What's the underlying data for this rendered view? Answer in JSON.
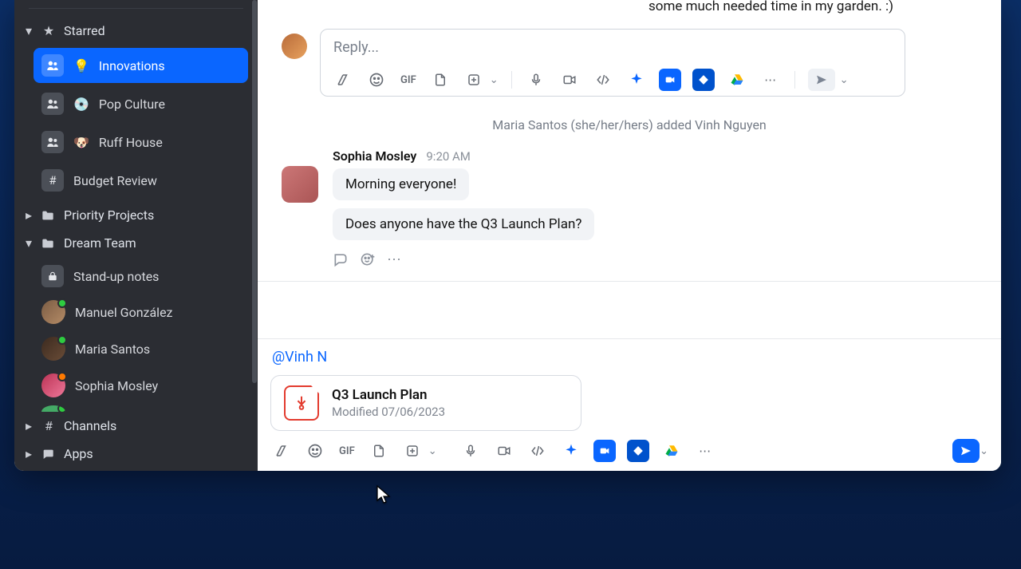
{
  "sidebar": {
    "sections": {
      "starred": {
        "label": "Starred"
      },
      "priority": {
        "label": "Priority Projects"
      },
      "dream": {
        "label": "Dream Team"
      },
      "channels": {
        "label": "Channels"
      },
      "apps": {
        "label": "Apps"
      }
    },
    "starred_channels": [
      {
        "label": "Innovations",
        "emoji": "💡",
        "active": true
      },
      {
        "label": "Pop Culture",
        "emoji": "💿",
        "active": false
      },
      {
        "label": "Ruff House",
        "emoji": "🐶",
        "active": false
      },
      {
        "label": "Budget Review",
        "emoji": "#",
        "active": false
      }
    ],
    "dream_items": [
      {
        "type": "channel",
        "label": "Stand-up notes",
        "icon": "lock"
      },
      {
        "type": "dm",
        "label": "Manuel González",
        "presence": "green"
      },
      {
        "type": "dm",
        "label": "Maria Santos",
        "presence": "green"
      },
      {
        "type": "dm",
        "label": "Sophia Mosley",
        "presence": "orange"
      }
    ]
  },
  "chat": {
    "partial_message": "some much needed time in my garden. :)",
    "reply_placeholder": "Reply...",
    "system_event": "Maria Santos (she/her/hers) added Vinh Nguyen",
    "message": {
      "author": "Sophia Mosley",
      "time": "9:20 AM",
      "body1": "Morning everyone!",
      "body2": "Does anyone have the Q3 Launch Plan?"
    },
    "composer_text_mention": "@Vinh N",
    "attachment": {
      "title": "Q3 Launch Plan",
      "subtitle": "Modified 07/06/2023"
    },
    "gif_label": "GIF"
  },
  "colors": {
    "accent": "#0a66ff",
    "sidebar_bg": "#2b2d33"
  }
}
